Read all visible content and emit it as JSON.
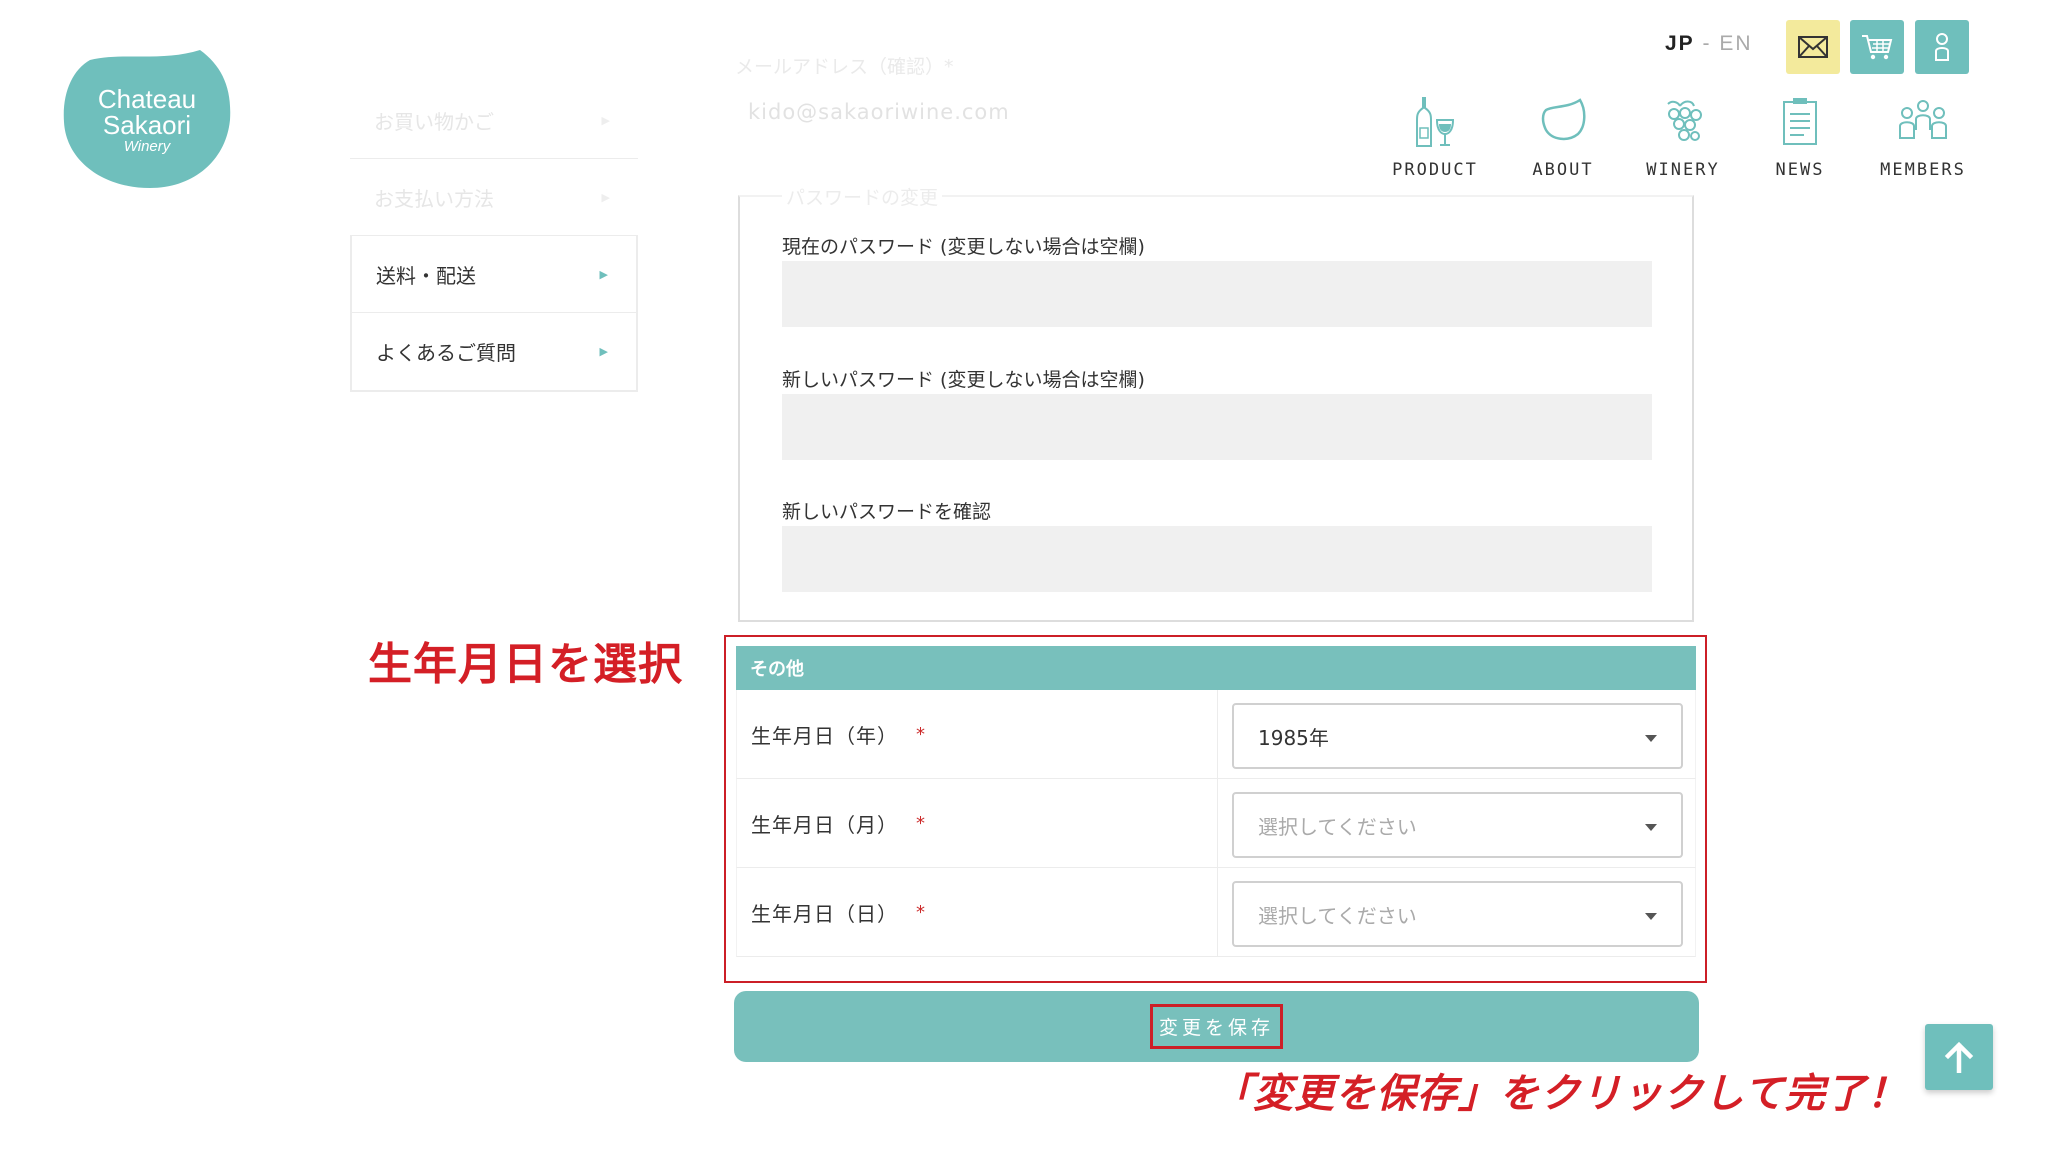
{
  "brand": {
    "line1": "Chateau",
    "line2": "Sakaori",
    "line3": "Winery",
    "color": "#6fbfbc"
  },
  "lang": {
    "jp": "JP",
    "sep": "-",
    "en": "EN"
  },
  "header_icons": [
    "mail-icon",
    "cart-icon",
    "user-icon"
  ],
  "nav": [
    {
      "label": "PRODUCT",
      "icon": "wine-bottle-icon"
    },
    {
      "label": "ABOUT",
      "icon": "wine-glass-icon"
    },
    {
      "label": "WINERY",
      "icon": "grapes-icon"
    },
    {
      "label": "NEWS",
      "icon": "clipboard-icon"
    },
    {
      "label": "MEMBERS",
      "icon": "people-icon"
    }
  ],
  "sidebar": {
    "items": [
      {
        "label": "お買い物かご"
      },
      {
        "label": "お支払い方法"
      },
      {
        "label": "送料・配送"
      },
      {
        "label": "よくあるご質問"
      }
    ]
  },
  "email_confirm": {
    "label": "メールアドレス（確認）*",
    "value": "kido@sakaoriwine.com"
  },
  "password": {
    "legend": "パスワードの変更",
    "current_label": "現在のパスワード (変更しない場合は空欄)",
    "new_label": "新しいパスワード (変更しない場合は空欄)",
    "confirm_label": "新しいパスワードを確認"
  },
  "other": {
    "heading": "その他",
    "rows": [
      {
        "label": "生年月日（年）",
        "required": "*",
        "value": "1985年"
      },
      {
        "label": "生年月日（月）",
        "required": "*",
        "value": "選択してください"
      },
      {
        "label": "生年月日（日）",
        "required": "*",
        "value": "選択してください"
      }
    ]
  },
  "save_button": {
    "label": "変更を保存"
  },
  "annotations": {
    "select_birthday": "生年月日を選択",
    "click_save": "「変更を保存」をクリックして完了！"
  },
  "colors": {
    "accent": "#78c0bc",
    "annotation": "#cc1f27",
    "mail_button": "#f3ea9c"
  }
}
